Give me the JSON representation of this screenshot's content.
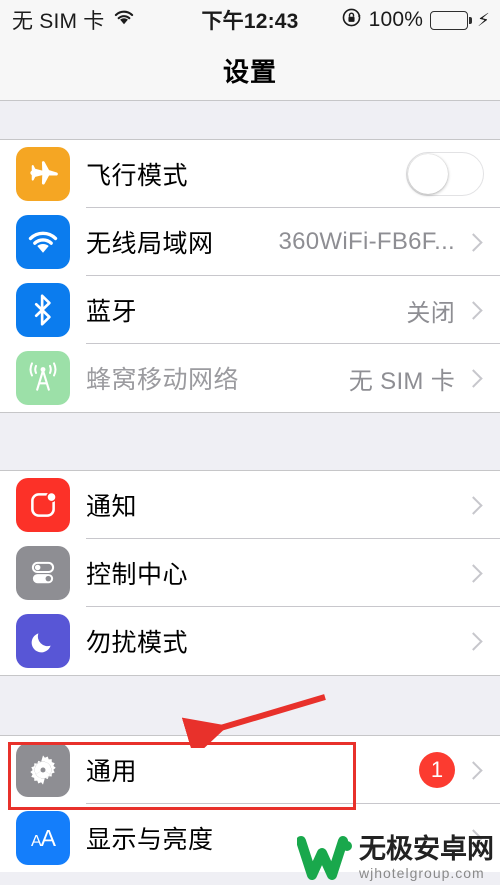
{
  "status_bar": {
    "carrier": "无 SIM 卡",
    "wifi_icon": "wifi-icon",
    "time": "下午12:43",
    "rotation_lock_icon": "rotation-lock-icon",
    "battery_percent": "100%",
    "battery_level": 100,
    "battery_color": "#4CD964",
    "charging_icon": "lightning-bolt-icon"
  },
  "nav": {
    "title": "设置"
  },
  "groups": [
    {
      "rows": [
        {
          "label": "飞行模式",
          "icon": "airplane-icon",
          "icon_color": "#F5A623",
          "accessory": "toggle",
          "toggle_on": false,
          "disabled": false
        },
        {
          "label": "无线局域网",
          "icon": "wifi-icon",
          "icon_color": "#0B7CEE",
          "accessory": "value",
          "value": "360WiFi-FB6F...",
          "disabled": false
        },
        {
          "label": "蓝牙",
          "icon": "bluetooth-icon",
          "icon_color": "#0B7CEE",
          "accessory": "value",
          "value": "关闭",
          "disabled": false
        },
        {
          "label": "蜂窝移动网络",
          "icon": "cellular-icon",
          "icon_color": "#9CE0A8",
          "accessory": "value",
          "value": "无 SIM 卡",
          "disabled": true
        }
      ]
    },
    {
      "rows": [
        {
          "label": "通知",
          "icon": "notifications-icon",
          "icon_color": "#FC3128",
          "accessory": "chevron",
          "disabled": false
        },
        {
          "label": "控制中心",
          "icon": "control-center-icon",
          "icon_color": "#8E8E93",
          "accessory": "chevron",
          "disabled": false
        },
        {
          "label": "勿扰模式",
          "icon": "do-not-disturb-icon",
          "icon_color": "#5856D6",
          "accessory": "chevron",
          "disabled": false
        }
      ]
    },
    {
      "rows": [
        {
          "label": "通用",
          "icon": "gear-icon",
          "icon_color": "#8E8E93",
          "accessory": "badge",
          "badge": "1",
          "badge_color": "#FC3B30",
          "highlighted": true,
          "disabled": false
        },
        {
          "label": "显示与亮度",
          "icon": "display-brightness-icon",
          "icon_color": "#147EFB",
          "accessory": "chevron",
          "disabled": false
        }
      ]
    }
  ],
  "annotation": {
    "highlight_color": "#E8312B",
    "arrow_color": "#E8312B",
    "target_row_label": "通用"
  },
  "watermark": {
    "logo": "w-logo-icon",
    "name": "无极安卓网",
    "url": "wjhotelgroup.com",
    "color": "#19A84C"
  }
}
